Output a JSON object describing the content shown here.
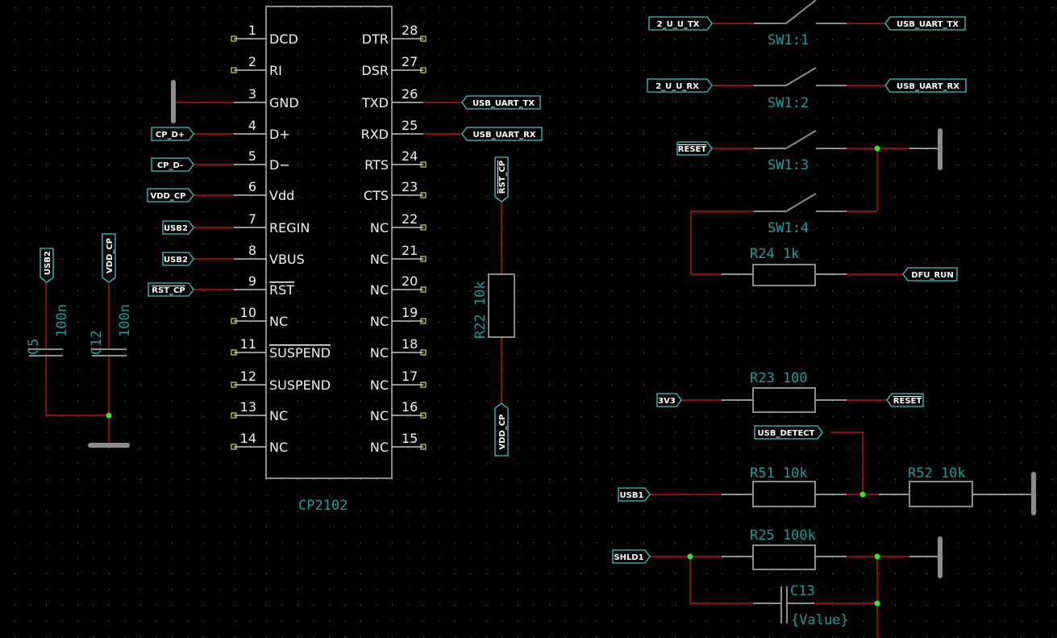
{
  "colors": {
    "background": "#000000",
    "wire": "#c01010",
    "component": "#8c8c8c",
    "reference_text": "#1b9a9a",
    "net_label_border": "#38c8c8",
    "junction": "#22ee22",
    "unconnected_pin": "#d8d860"
  },
  "ic": {
    "name": "CP2102",
    "left_pins": [
      {
        "num": "1",
        "name": "DCD"
      },
      {
        "num": "2",
        "name": "RI"
      },
      {
        "num": "3",
        "name": "GND"
      },
      {
        "num": "4",
        "name": "D+"
      },
      {
        "num": "5",
        "name": "D−"
      },
      {
        "num": "6",
        "name": "Vdd"
      },
      {
        "num": "7",
        "name": "REGIN"
      },
      {
        "num": "8",
        "name": "VBUS"
      },
      {
        "num": "9",
        "name": "RST",
        "overbar": true
      },
      {
        "num": "10",
        "name": "NC"
      },
      {
        "num": "11",
        "name": "SUSPEND",
        "overbar": true
      },
      {
        "num": "12",
        "name": "SUSPEND"
      },
      {
        "num": "13",
        "name": "NC"
      },
      {
        "num": "14",
        "name": "NC"
      }
    ],
    "right_pins": [
      {
        "num": "28",
        "name": "DTR"
      },
      {
        "num": "27",
        "name": "DSR"
      },
      {
        "num": "26",
        "name": "TXD"
      },
      {
        "num": "25",
        "name": "RXD"
      },
      {
        "num": "24",
        "name": "RTS"
      },
      {
        "num": "23",
        "name": "CTS"
      },
      {
        "num": "22",
        "name": "NC"
      },
      {
        "num": "21",
        "name": "NC"
      },
      {
        "num": "20",
        "name": "NC"
      },
      {
        "num": "19",
        "name": "NC"
      },
      {
        "num": "18",
        "name": "NC"
      },
      {
        "num": "17",
        "name": "NC"
      },
      {
        "num": "16",
        "name": "NC"
      },
      {
        "num": "15",
        "name": "NC"
      }
    ]
  },
  "net_labels": {
    "cp_d_plus": "CP_D+",
    "cp_d_minus": "CP_D-",
    "vdd_cp_pin6": "VDD_CP",
    "usb2_pin7": "USB2",
    "usb2_pin8": "USB2",
    "rst_cp_pin9": "RST_CP",
    "usb_uart_tx_pin26": "USB_UART_TX",
    "usb_uart_rx_pin25": "USB_UART_RX",
    "usb2_c5": "USB2",
    "vdd_cp_c12": "VDD_CP",
    "rst_cp_r22": "RST_CP",
    "vdd_cp_r22": "VDD_CP",
    "sw1_in_tx": "2_U_U_TX",
    "sw1_out_tx": "USB_UART_TX",
    "sw2_in_rx": "2_U_U_RX",
    "sw2_out_rx": "USB_UART_RX",
    "reset_sw3": "RESET",
    "dfu_run": "DFU_RUN",
    "v3v3": "3V3",
    "reset_r23": "RESET",
    "usb_detect": "USB_DETECT",
    "usb1": "USB1",
    "shld1": "SHLD1"
  },
  "components": {
    "c5": {
      "ref": "C5",
      "value": "100n"
    },
    "c12": {
      "ref": "C12",
      "value": "100n"
    },
    "r22": {
      "ref_value": "R22 10k"
    },
    "sw1_1": "SW1:1",
    "sw1_2": "SW1:2",
    "sw1_3": "SW1:3",
    "sw1_4": "SW1:4",
    "r24": "R24 1k",
    "r23": "R23 100",
    "r51": "R51 10k",
    "r52": "R52 10k",
    "r25": "R25 100k",
    "c13": {
      "ref": "C13",
      "value": "{Value}"
    }
  }
}
